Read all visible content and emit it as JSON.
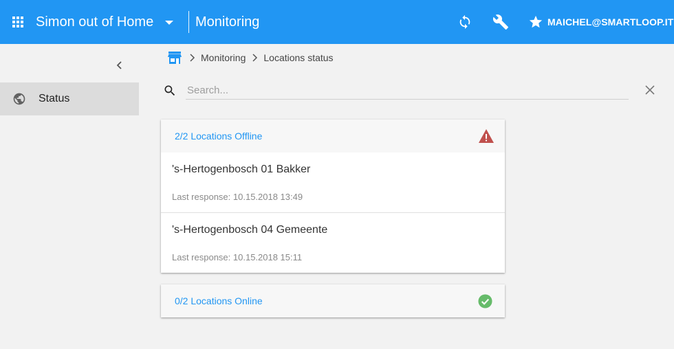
{
  "appbar": {
    "app_title": "Simon out of Home",
    "section_title": "Monitoring",
    "user_label": "MAICHEL@SMARTLOOP.IT",
    "color": "#2196f3"
  },
  "sidebar": {
    "items": [
      {
        "label": "Status",
        "icon": "globe-icon"
      }
    ]
  },
  "breadcrumb": {
    "items": [
      "Monitoring",
      "Locations status"
    ]
  },
  "search": {
    "placeholder": "Search...",
    "value": ""
  },
  "cards": {
    "offline": {
      "title": "2/2 Locations Offline",
      "status_icon": "warning-icon",
      "status_color": "#c0504d",
      "locations": [
        {
          "name": "'s-Hertogenbosch 01 Bakker",
          "last_response": "Last response: 10.15.2018 13:49"
        },
        {
          "name": "'s-Hertogenbosch 04 Gemeente",
          "last_response": "Last response: 10.15.2018 15:11"
        }
      ]
    },
    "online": {
      "title": "0/2 Locations Online",
      "status_icon": "check-circle-icon",
      "status_color": "#66bb6a"
    }
  }
}
